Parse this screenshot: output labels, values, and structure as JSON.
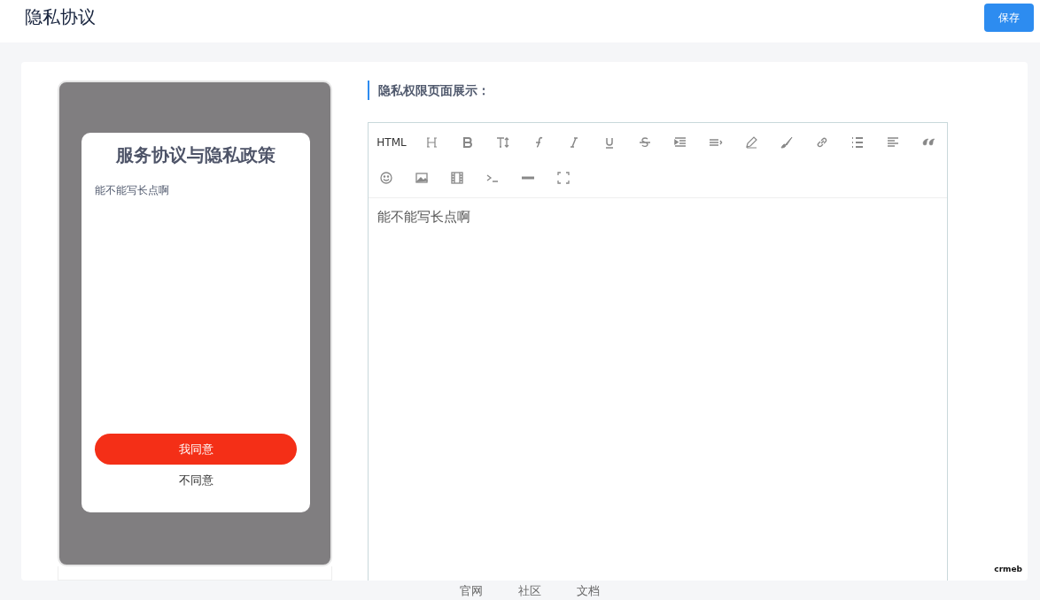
{
  "header": {
    "title": "隐私协议",
    "save_button": "保存"
  },
  "preview": {
    "title": "服务协议与隐私政策",
    "body": "能不能写长点啊",
    "agree_button": "我同意",
    "disagree_link": "不同意"
  },
  "section_title": "隐私权限页面展示：",
  "editor": {
    "html_button": "HTML",
    "content": "能不能写长点啊"
  },
  "logo": "crmeb",
  "footer_links": [
    "官网",
    "社区",
    "文档"
  ]
}
